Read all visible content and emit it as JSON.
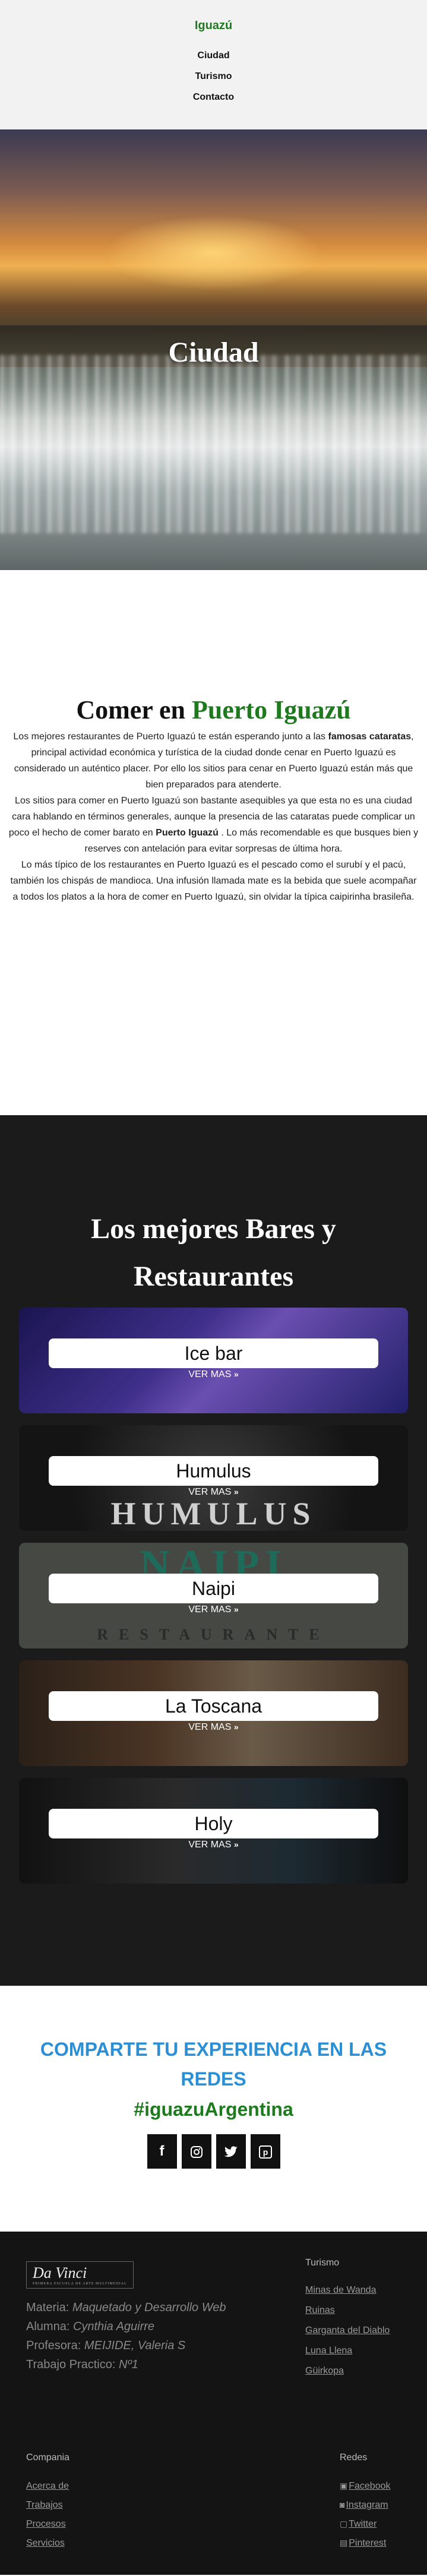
{
  "header": {
    "brand": "Iguazú",
    "nav": [
      "Ciudad",
      "Turismo",
      "Contacto"
    ]
  },
  "hero": {
    "title": "Ciudad"
  },
  "about": {
    "title_prefix": "Comer en",
    "title_highlight": "Puerto Iguazú",
    "p1_a": "Los mejores restaurantes de Puerto Iguazú te están esperando junto a las ",
    "p1_bold": "famosas cataratas",
    "p1_b": ", principal actividad económica y turística de la ciudad donde cenar en Puerto Iguazú es considerado un auténtico placer. Por ello los sitios para cenar en Puerto Iguazú están más que bien preparados para atenderte.",
    "p2_a": "Los sitios para comer en Puerto Iguazú son bastante asequibles ya que esta no es una ciudad cara hablando en términos generales, aunque la presencia de las cataratas puede complicar un poco el hecho de comer barato en ",
    "p2_bold": "Puerto Iguazú",
    "p2_b": " . Lo más recomendable es que busques bien y reserves con antelación para evitar sorpresas de última hora.",
    "p3": "Lo más típico de los restaurantes en Puerto Iguazú es el pescado como el surubí y el pacú, también los chispás de mandioca. Una infusión llamada mate es la bebida que suele acompañar a todos los platos a la hora de comer en Puerto Iguazú, sin olvidar la típica caipirinha brasileña."
  },
  "bars": {
    "title_line1": "Los mejores Bares y",
    "title_line2": "Restaurantes",
    "more_label": "VER MAS",
    "items": [
      {
        "name": "Ice bar"
      },
      {
        "name": "Humulus",
        "decor": "HUMULUS"
      },
      {
        "name": "Naipi",
        "decor_top": "NAIPI",
        "decor_bottom": "RESTAURANTE"
      },
      {
        "name": "La Toscana"
      },
      {
        "name": "Holy"
      }
    ]
  },
  "share": {
    "title": "COMPARTE TU EXPERIENCIA EN LAS REDES",
    "hashtag": "#iguazuArgentina",
    "icons": [
      "facebook-icon",
      "instagram-icon",
      "twitter-icon",
      "pinterest-icon"
    ]
  },
  "footer": {
    "logo": "Da Vinci",
    "logo_sub": "PRIMERA ESCUELA DE ARTE MULTIMEDIAL",
    "materia_label": "Materia: ",
    "materia_value": "Maquetado y Desarrollo Web",
    "alumna_label": "Alumna: ",
    "alumna_value": "Cynthia Aguirre",
    "profesora_label": "Profesora: ",
    "profesora_value": "MEIJIDE, Valeria S",
    "trabajo_label": "Trabajo Practico: ",
    "trabajo_value": "Nº1",
    "turismo_title": "Turismo",
    "turismo_links": [
      "Minas de Wanda",
      "Ruinas",
      "Garganta del Diablo",
      "Luna Llena",
      "Güirkopa"
    ],
    "compania_title": "Compania",
    "compania_links": [
      "Acerca de",
      "Trabajos",
      "Procesos",
      "Servicios"
    ],
    "redes_title": "Redes",
    "redes_links": [
      "Facebook",
      "Instagram",
      "Twitter",
      "Pinterest"
    ]
  }
}
